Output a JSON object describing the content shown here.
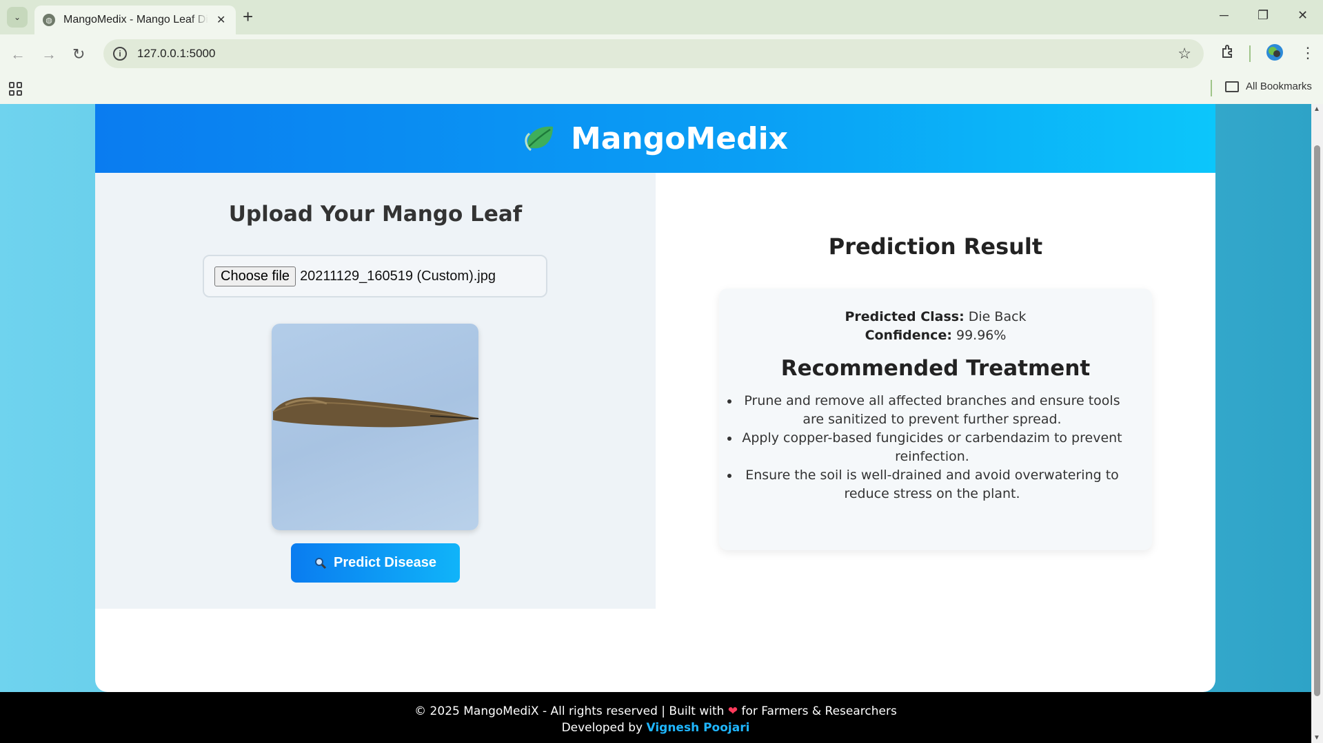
{
  "browser": {
    "tab_title": "MangoMedix - Mango Leaf Disease Detection",
    "url": "127.0.0.1:5000",
    "bookmarks_label": "All Bookmarks",
    "new_tab_symbol": "+",
    "tab_close_symbol": "✕",
    "minimize_symbol": "─",
    "restore_symbol": "❐",
    "close_symbol": "✕",
    "back_symbol": "←",
    "forward_symbol": "→",
    "reload_symbol": "↻",
    "star_symbol": "☆",
    "menu_symbol": "⋮",
    "tab_list_symbol": "⌄"
  },
  "header": {
    "title": "MangoMedix",
    "logo_icon": "leaf-icon"
  },
  "upload": {
    "title": "Upload Your Mango Leaf",
    "choose_file_label": "Choose file",
    "file_name": "20211129_160519 (Custom).jpg",
    "predict_label": "Predict Disease"
  },
  "result": {
    "title": "Prediction Result",
    "predicted_class_label": "Predicted Class:",
    "predicted_class_value": "Die Back",
    "confidence_label": "Confidence:",
    "confidence_value": "99.96%",
    "treatment_title": "Recommended Treatment",
    "treatments": [
      "Prune and remove all affected branches and ensure tools are sanitized to prevent further spread.",
      "Apply copper-based fungicides or carbendazim to prevent reinfection.",
      "Ensure the soil is well-drained and avoid overwatering to reduce stress on the plant."
    ]
  },
  "footer": {
    "copyright_prefix": "© 2025 MangoMediX - All rights reserved | Built with",
    "heart": "❤",
    "copyright_suffix": "for Farmers & Researchers",
    "developed_by": "Developed by",
    "developer": "Vignesh Poojari"
  },
  "colors": {
    "header_start": "#0a7cf0",
    "header_end": "#0cc6fb",
    "developer_link": "#1fb6ff"
  }
}
